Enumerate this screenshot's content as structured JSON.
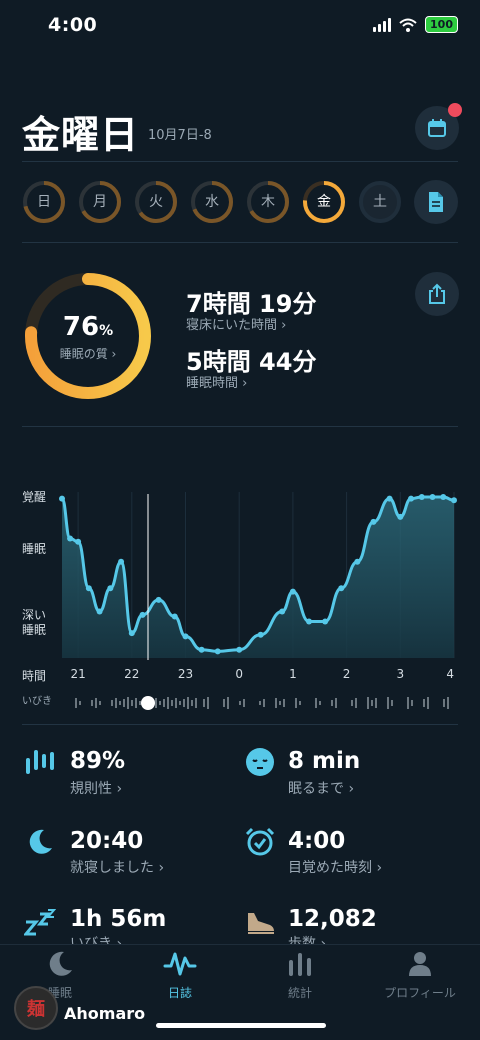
{
  "status": {
    "time": "4:00",
    "battery": "100"
  },
  "header": {
    "day": "金曜日",
    "date": "10月7日-8"
  },
  "week": [
    {
      "label": "日",
      "state": "past"
    },
    {
      "label": "月",
      "state": "past"
    },
    {
      "label": "火",
      "state": "past"
    },
    {
      "label": "水",
      "state": "past"
    },
    {
      "label": "木",
      "state": "past"
    },
    {
      "label": "金",
      "state": "active"
    },
    {
      "label": "土",
      "state": "future"
    }
  ],
  "summary": {
    "quality_value": "76",
    "quality_unit": "%",
    "quality_label": "睡眠の質 ›",
    "quality_fraction": 0.76,
    "bed_time_value": "7時間 19分",
    "bed_time_label": "寝床にいた時間 ›",
    "sleep_time_value": "5時間 44分",
    "sleep_time_label": "睡眠時間 ›"
  },
  "chart": {
    "y_awake": "覚醒",
    "y_sleep": "睡眠",
    "y_deep1": "深い",
    "y_deep2": "睡眠",
    "x_title": "時間",
    "x_ticks": [
      "21",
      "22",
      "23",
      "0",
      "1",
      "2",
      "3",
      "4"
    ],
    "snore_label": "いびき"
  },
  "chart_data": {
    "type": "area",
    "y_categories": [
      "深い睡眠",
      "睡眠",
      "覚醒"
    ],
    "ylim": [
      0,
      1
    ],
    "x_ticks": [
      "21",
      "22",
      "23",
      "0",
      "1",
      "2",
      "3",
      "4"
    ],
    "x": [
      20.7,
      20.85,
      21.0,
      21.2,
      21.4,
      21.6,
      21.8,
      22.0,
      22.2,
      22.5,
      22.8,
      23.0,
      23.3,
      23.6,
      24.0,
      24.4,
      24.8,
      25.0,
      25.3,
      25.6,
      25.9,
      26.2,
      26.5,
      26.8,
      27.0,
      27.2,
      27.4,
      27.6,
      27.8,
      28.0
    ],
    "y": [
      0.96,
      0.72,
      0.7,
      0.42,
      0.28,
      0.42,
      0.58,
      0.15,
      0.26,
      0.35,
      0.25,
      0.13,
      0.05,
      0.04,
      0.05,
      0.14,
      0.28,
      0.4,
      0.22,
      0.22,
      0.42,
      0.58,
      0.82,
      0.96,
      0.85,
      0.96,
      0.97,
      0.97,
      0.97,
      0.95
    ]
  },
  "metrics": [
    {
      "icon": "regularity-icon",
      "value": "89%",
      "label": "規則性 ›"
    },
    {
      "icon": "sleepy-face-icon",
      "value": "8 min",
      "label": "眠るまで ›"
    },
    {
      "icon": "moon-icon",
      "value": "20:40",
      "label": "就寝しました ›"
    },
    {
      "icon": "alarm-clock-icon",
      "value": "4:00",
      "label": "目覚めた時刻 ›"
    },
    {
      "icon": "zzz-icon",
      "value": "1h 56m",
      "label": "いびき ›"
    },
    {
      "icon": "shoe-icon",
      "value": "12,082",
      "label": "歩数 ›"
    }
  ],
  "tabs": [
    {
      "icon": "moon-icon",
      "label": "睡眠"
    },
    {
      "icon": "wave-icon",
      "label": "日誌"
    },
    {
      "icon": "bars-icon",
      "label": "統計"
    },
    {
      "icon": "person-icon",
      "label": "プロフィール"
    }
  ],
  "user": {
    "name": "Ahomaro",
    "badge": "麺"
  },
  "colors": {
    "accent": "#56c8e8",
    "ring": "#f4a93a",
    "bg": "#0f1b25"
  }
}
